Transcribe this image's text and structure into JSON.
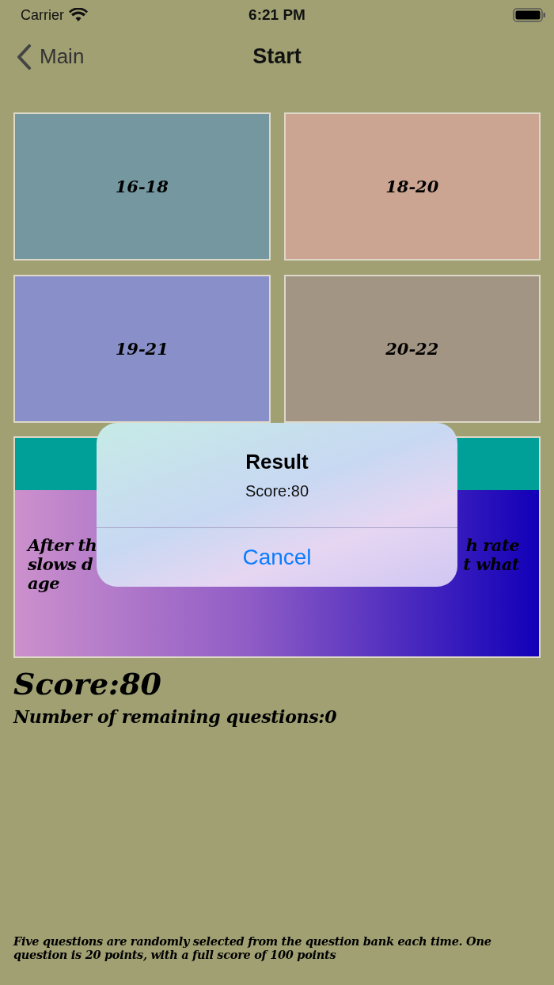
{
  "status_bar": {
    "carrier": "Carrier",
    "time": "6:21 PM"
  },
  "nav_bar": {
    "back_label": "Main",
    "title": "Start"
  },
  "options": [
    {
      "label": "16-18",
      "color": "#7597a0"
    },
    {
      "label": "18-20",
      "color": "#cba592"
    },
    {
      "label": "19-21",
      "color": "#8990c9"
    },
    {
      "label": "20-22",
      "color": "#a39584"
    }
  ],
  "question": {
    "visible_left": "After th\nslows d\nage",
    "visible_right": "h rate\nt what"
  },
  "score": "Score:80",
  "remaining": "Number of remaining questions:0",
  "footer": "Five questions are randomly selected from the question bank each time. One question is 20 points, with a full score of 100 points",
  "alert": {
    "title": "Result",
    "message": "Score:80",
    "buttons": [
      "Cancel"
    ]
  }
}
